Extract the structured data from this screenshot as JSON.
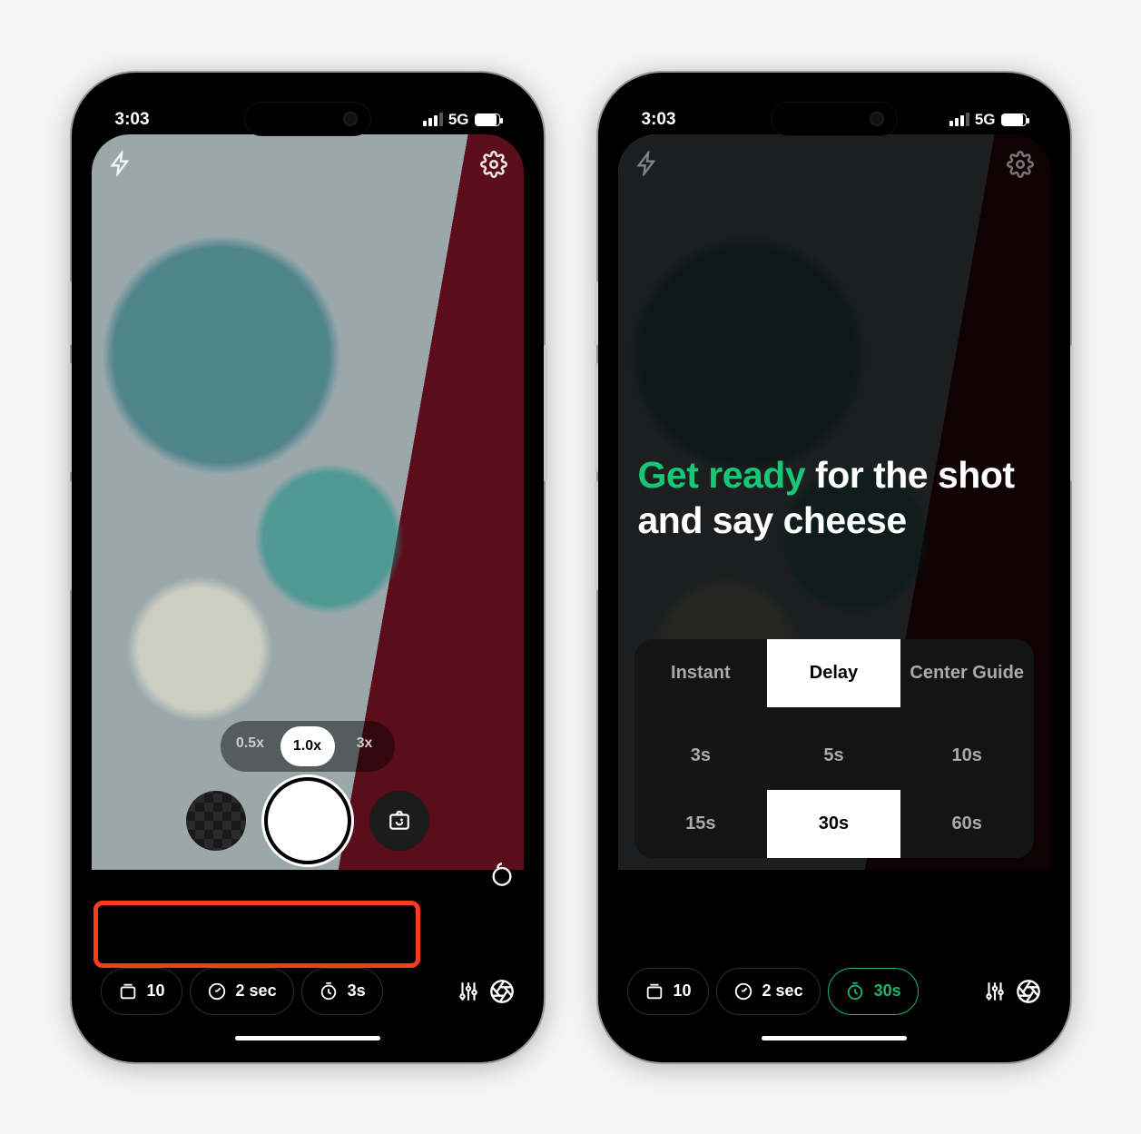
{
  "status": {
    "time": "3:03",
    "network": "5G"
  },
  "phone1": {
    "zoom": {
      "out": "0.5x",
      "main": "1.0x",
      "tele": "3x"
    },
    "pills": {
      "burst": "10",
      "interval": "2 sec",
      "delay": "3s"
    }
  },
  "phone2": {
    "headline": {
      "accent": "Get ready",
      "rest1": " for the shot",
      "rest2": "and say cheese"
    },
    "tabs": {
      "instant": "Instant",
      "delay": "Delay",
      "guide": "Center Guide"
    },
    "options": {
      "o1": "3s",
      "o2": "5s",
      "o3": "10s",
      "o4": "15s",
      "o5": "30s",
      "o6": "60s"
    },
    "pills": {
      "burst": "10",
      "interval": "2 sec",
      "delay": "30s"
    }
  }
}
